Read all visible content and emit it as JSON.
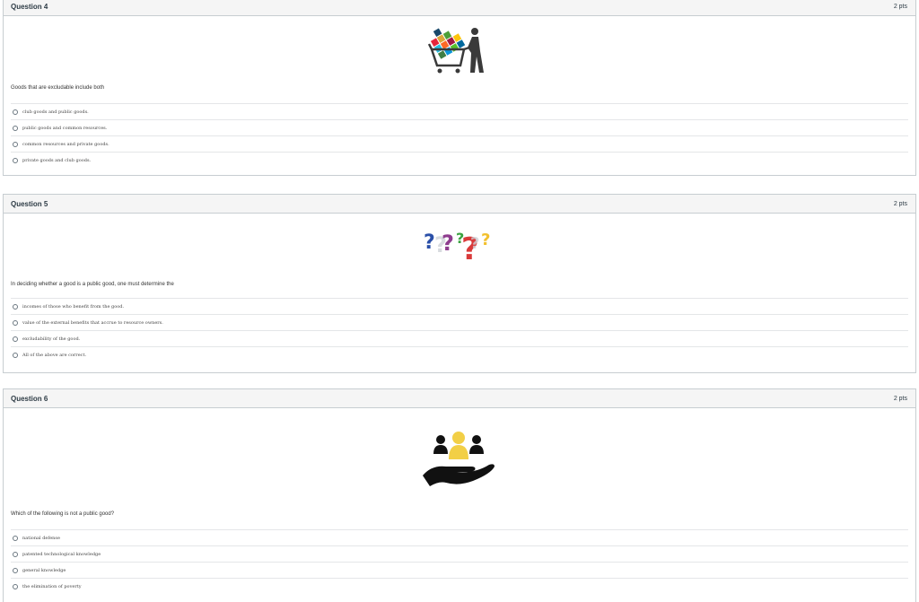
{
  "questions": [
    {
      "title": "Question 4",
      "points": "2 pts",
      "image_icon": "shopping-cart-person-icon",
      "text": "Goods that are excludable include both",
      "answers": [
        "club goods and public goods.",
        "public goods and common resources.",
        "common resources and private goods.",
        "private goods and club goods."
      ]
    },
    {
      "title": "Question 5",
      "points": "2 pts",
      "image_icon": "question-marks-icon",
      "text": "In deciding whether a good is a public good, one must determine the",
      "answers": [
        "incomes of those who benefit from the good.",
        "value of the external benefits that accrue to resource owners.",
        "excludability of the good.",
        "All of the above are correct."
      ]
    },
    {
      "title": "Question 6",
      "points": "2 pts",
      "image_icon": "hand-holding-people-icon",
      "text": "Which of the following is not a public good?",
      "answers": [
        "national defense",
        "patented technological knowledge",
        "general knowledge",
        "the elimination of poverty"
      ]
    }
  ]
}
